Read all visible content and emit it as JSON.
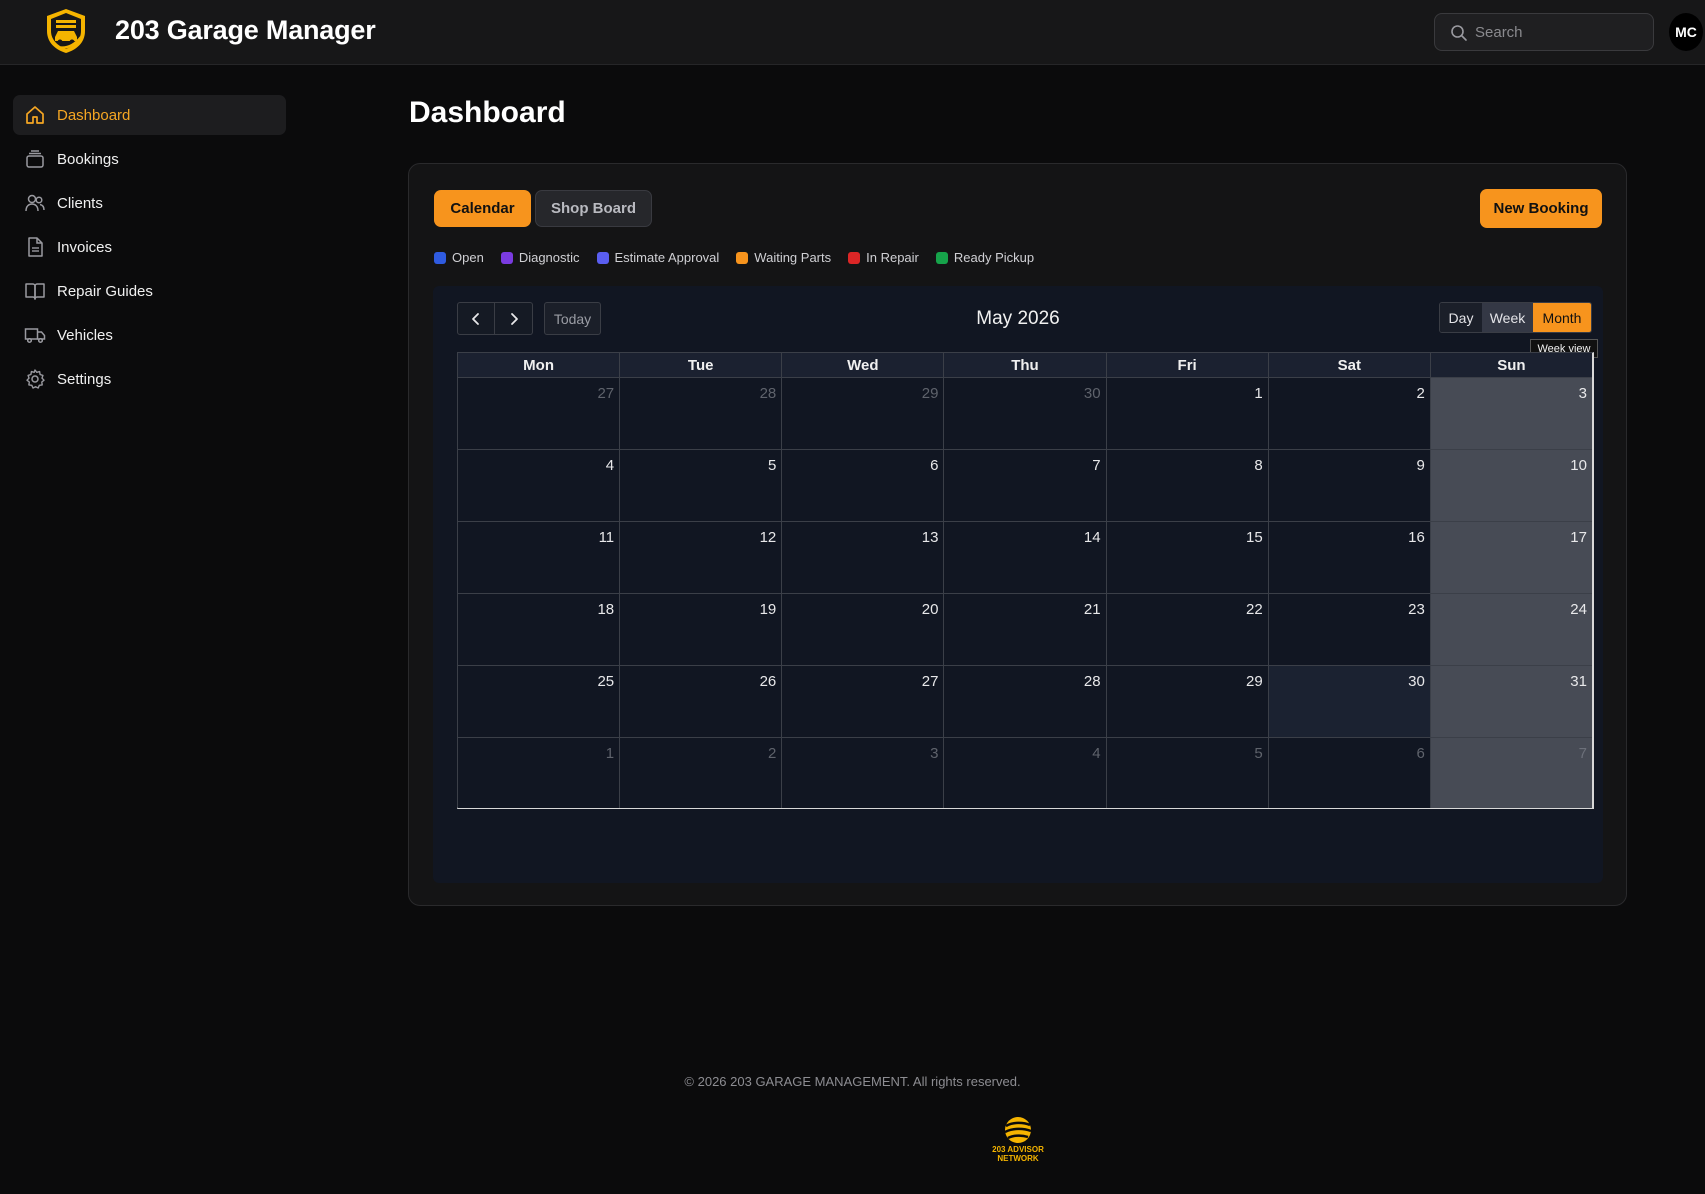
{
  "header": {
    "app_title": "203 Garage Manager",
    "search_placeholder": "Search",
    "user_initials": "MC"
  },
  "sidebar": {
    "items": [
      {
        "label": "Dashboard",
        "icon": "home-icon",
        "active": true
      },
      {
        "label": "Bookings",
        "icon": "layers-icon"
      },
      {
        "label": "Clients",
        "icon": "users-icon"
      },
      {
        "label": "Invoices",
        "icon": "file-icon"
      },
      {
        "label": "Repair Guides",
        "icon": "book-icon"
      },
      {
        "label": "Vehicles",
        "icon": "truck-icon"
      },
      {
        "label": "Settings",
        "icon": "gear-icon"
      }
    ]
  },
  "main": {
    "page_title": "Dashboard",
    "tabs": [
      {
        "label": "Calendar",
        "active": true
      },
      {
        "label": "Shop Board",
        "active": false
      }
    ],
    "new_booking_label": "New Booking",
    "legend": [
      {
        "label": "Open",
        "color": "#2f5be0"
      },
      {
        "label": "Diagnostic",
        "color": "#7a3be0"
      },
      {
        "label": "Estimate Approval",
        "color": "#5a5ef0"
      },
      {
        "label": "Waiting Parts",
        "color": "#f7941d"
      },
      {
        "label": "In Repair",
        "color": "#dc2626"
      },
      {
        "label": "Ready Pickup",
        "color": "#16a34a"
      }
    ]
  },
  "calendar": {
    "today_label": "Today",
    "month_label": "May 2026",
    "views": {
      "day": "Day",
      "week": "Week",
      "month": "Month",
      "active": "Month"
    },
    "tooltip": "Week view",
    "weekdays": [
      "Mon",
      "Tue",
      "Wed",
      "Thu",
      "Fri",
      "Sat",
      "Sun"
    ],
    "today_date": 30,
    "weeks": [
      [
        {
          "d": "27",
          "off": true
        },
        {
          "d": "28",
          "off": true
        },
        {
          "d": "29",
          "off": true
        },
        {
          "d": "30",
          "off": true
        },
        {
          "d": "1"
        },
        {
          "d": "2"
        },
        {
          "d": "3"
        }
      ],
      [
        {
          "d": "4"
        },
        {
          "d": "5"
        },
        {
          "d": "6"
        },
        {
          "d": "7"
        },
        {
          "d": "8"
        },
        {
          "d": "9"
        },
        {
          "d": "10"
        }
      ],
      [
        {
          "d": "11"
        },
        {
          "d": "12"
        },
        {
          "d": "13"
        },
        {
          "d": "14"
        },
        {
          "d": "15"
        },
        {
          "d": "16"
        },
        {
          "d": "17"
        }
      ],
      [
        {
          "d": "18"
        },
        {
          "d": "19"
        },
        {
          "d": "20"
        },
        {
          "d": "21"
        },
        {
          "d": "22"
        },
        {
          "d": "23"
        },
        {
          "d": "24"
        }
      ],
      [
        {
          "d": "25"
        },
        {
          "d": "26"
        },
        {
          "d": "27"
        },
        {
          "d": "28"
        },
        {
          "d": "29"
        },
        {
          "d": "30",
          "today": true
        },
        {
          "d": "31"
        }
      ],
      [
        {
          "d": "1",
          "off": true
        },
        {
          "d": "2",
          "off": true
        },
        {
          "d": "3",
          "off": true
        },
        {
          "d": "4",
          "off": true
        },
        {
          "d": "5",
          "off": true
        },
        {
          "d": "6",
          "off": true
        },
        {
          "d": "7",
          "off": true
        }
      ]
    ]
  },
  "footer": {
    "copyright": "© 2026 203 GARAGE MANAGEMENT. All rights reserved.",
    "logo_line1": "203 ADVISOR",
    "logo_line2": "NETWORK"
  },
  "colors": {
    "accent": "#f7941d",
    "background": "#0b0b0c"
  }
}
